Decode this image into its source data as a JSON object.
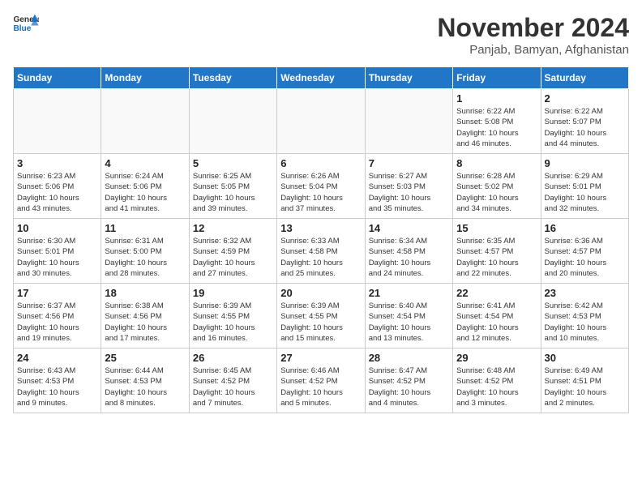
{
  "logo": {
    "general": "General",
    "blue": "Blue"
  },
  "title": "November 2024",
  "subtitle": "Panjab, Bamyan, Afghanistan",
  "days_of_week": [
    "Sunday",
    "Monday",
    "Tuesday",
    "Wednesday",
    "Thursday",
    "Friday",
    "Saturday"
  ],
  "weeks": [
    [
      {
        "day": "",
        "info": ""
      },
      {
        "day": "",
        "info": ""
      },
      {
        "day": "",
        "info": ""
      },
      {
        "day": "",
        "info": ""
      },
      {
        "day": "",
        "info": ""
      },
      {
        "day": "1",
        "info": "Sunrise: 6:22 AM\nSunset: 5:08 PM\nDaylight: 10 hours\nand 46 minutes."
      },
      {
        "day": "2",
        "info": "Sunrise: 6:22 AM\nSunset: 5:07 PM\nDaylight: 10 hours\nand 44 minutes."
      }
    ],
    [
      {
        "day": "3",
        "info": "Sunrise: 6:23 AM\nSunset: 5:06 PM\nDaylight: 10 hours\nand 43 minutes."
      },
      {
        "day": "4",
        "info": "Sunrise: 6:24 AM\nSunset: 5:06 PM\nDaylight: 10 hours\nand 41 minutes."
      },
      {
        "day": "5",
        "info": "Sunrise: 6:25 AM\nSunset: 5:05 PM\nDaylight: 10 hours\nand 39 minutes."
      },
      {
        "day": "6",
        "info": "Sunrise: 6:26 AM\nSunset: 5:04 PM\nDaylight: 10 hours\nand 37 minutes."
      },
      {
        "day": "7",
        "info": "Sunrise: 6:27 AM\nSunset: 5:03 PM\nDaylight: 10 hours\nand 35 minutes."
      },
      {
        "day": "8",
        "info": "Sunrise: 6:28 AM\nSunset: 5:02 PM\nDaylight: 10 hours\nand 34 minutes."
      },
      {
        "day": "9",
        "info": "Sunrise: 6:29 AM\nSunset: 5:01 PM\nDaylight: 10 hours\nand 32 minutes."
      }
    ],
    [
      {
        "day": "10",
        "info": "Sunrise: 6:30 AM\nSunset: 5:01 PM\nDaylight: 10 hours\nand 30 minutes."
      },
      {
        "day": "11",
        "info": "Sunrise: 6:31 AM\nSunset: 5:00 PM\nDaylight: 10 hours\nand 28 minutes."
      },
      {
        "day": "12",
        "info": "Sunrise: 6:32 AM\nSunset: 4:59 PM\nDaylight: 10 hours\nand 27 minutes."
      },
      {
        "day": "13",
        "info": "Sunrise: 6:33 AM\nSunset: 4:58 PM\nDaylight: 10 hours\nand 25 minutes."
      },
      {
        "day": "14",
        "info": "Sunrise: 6:34 AM\nSunset: 4:58 PM\nDaylight: 10 hours\nand 24 minutes."
      },
      {
        "day": "15",
        "info": "Sunrise: 6:35 AM\nSunset: 4:57 PM\nDaylight: 10 hours\nand 22 minutes."
      },
      {
        "day": "16",
        "info": "Sunrise: 6:36 AM\nSunset: 4:57 PM\nDaylight: 10 hours\nand 20 minutes."
      }
    ],
    [
      {
        "day": "17",
        "info": "Sunrise: 6:37 AM\nSunset: 4:56 PM\nDaylight: 10 hours\nand 19 minutes."
      },
      {
        "day": "18",
        "info": "Sunrise: 6:38 AM\nSunset: 4:56 PM\nDaylight: 10 hours\nand 17 minutes."
      },
      {
        "day": "19",
        "info": "Sunrise: 6:39 AM\nSunset: 4:55 PM\nDaylight: 10 hours\nand 16 minutes."
      },
      {
        "day": "20",
        "info": "Sunrise: 6:39 AM\nSunset: 4:55 PM\nDaylight: 10 hours\nand 15 minutes."
      },
      {
        "day": "21",
        "info": "Sunrise: 6:40 AM\nSunset: 4:54 PM\nDaylight: 10 hours\nand 13 minutes."
      },
      {
        "day": "22",
        "info": "Sunrise: 6:41 AM\nSunset: 4:54 PM\nDaylight: 10 hours\nand 12 minutes."
      },
      {
        "day": "23",
        "info": "Sunrise: 6:42 AM\nSunset: 4:53 PM\nDaylight: 10 hours\nand 10 minutes."
      }
    ],
    [
      {
        "day": "24",
        "info": "Sunrise: 6:43 AM\nSunset: 4:53 PM\nDaylight: 10 hours\nand 9 minutes."
      },
      {
        "day": "25",
        "info": "Sunrise: 6:44 AM\nSunset: 4:53 PM\nDaylight: 10 hours\nand 8 minutes."
      },
      {
        "day": "26",
        "info": "Sunrise: 6:45 AM\nSunset: 4:52 PM\nDaylight: 10 hours\nand 7 minutes."
      },
      {
        "day": "27",
        "info": "Sunrise: 6:46 AM\nSunset: 4:52 PM\nDaylight: 10 hours\nand 5 minutes."
      },
      {
        "day": "28",
        "info": "Sunrise: 6:47 AM\nSunset: 4:52 PM\nDaylight: 10 hours\nand 4 minutes."
      },
      {
        "day": "29",
        "info": "Sunrise: 6:48 AM\nSunset: 4:52 PM\nDaylight: 10 hours\nand 3 minutes."
      },
      {
        "day": "30",
        "info": "Sunrise: 6:49 AM\nSunset: 4:51 PM\nDaylight: 10 hours\nand 2 minutes."
      }
    ]
  ]
}
